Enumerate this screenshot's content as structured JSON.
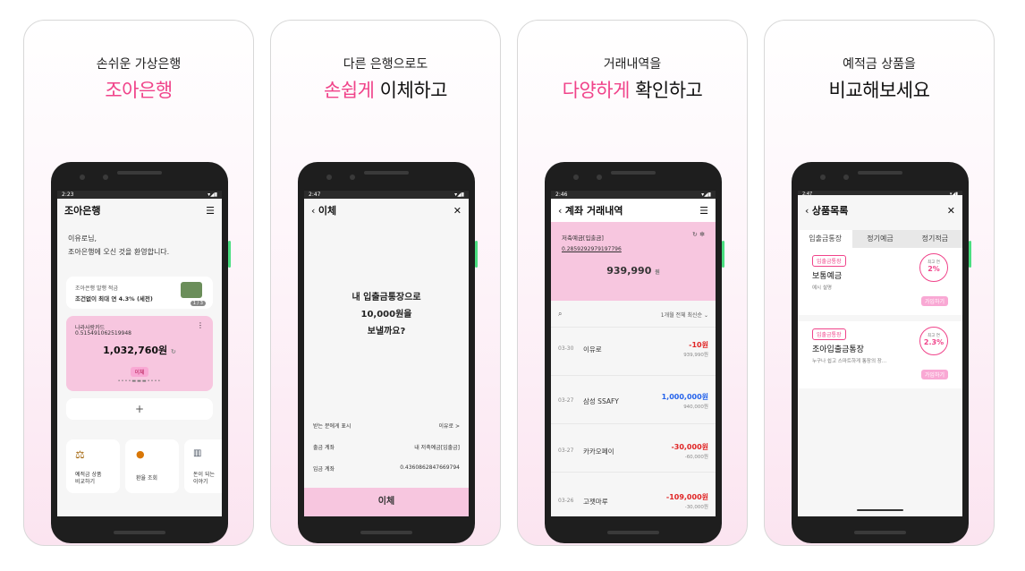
{
  "panels": [
    {
      "caption_line1": "손쉬운 가상은행",
      "caption_highlight": "조아은행",
      "caption_rest": ""
    },
    {
      "caption_line1": "다른 은행으로도",
      "caption_highlight": "손쉽게",
      "caption_rest": " 이체하고"
    },
    {
      "caption_line1": "거래내역을",
      "caption_highlight": "다양하게",
      "caption_rest": " 확인하고"
    },
    {
      "caption_line1": "예적금 상품을",
      "caption_highlight": "",
      "caption_rest": "비교해보세요"
    }
  ],
  "screen1": {
    "time": "2:23",
    "title": "조아은행",
    "welcome_line1": "이유로님,",
    "welcome_line2": "조아은행에 오신 것을 환영합니다.",
    "promo_line1": "조아은행 발행 적금",
    "promo_line2": "조건없이 최대 연 4.3% (세전)",
    "promo_page": "1 / 3",
    "account_name": "나라사랑카드",
    "account_number": "0.515491062519948",
    "balance": "1,032,760원",
    "transfer_btn": "이체",
    "add_btn": "+",
    "quick": [
      {
        "label1": "예적금 상품",
        "label2": "비교하기"
      },
      {
        "label1": "환율 조회",
        "label2": ""
      },
      {
        "label1": "돈이 되는",
        "label2": "이야기"
      }
    ]
  },
  "screen2": {
    "time": "2:47",
    "title": "이체",
    "q1": "내 입출금통장으로",
    "q2": "10,000원을",
    "q3": "보낼까요?",
    "rows": [
      {
        "label": "받는 분에게 표시",
        "value": "이유로 >"
      },
      {
        "label": "출금 계좌",
        "value": "내 저축예금[입출금]"
      },
      {
        "label": "입금 계좌",
        "value": "0.4360862847669794"
      }
    ],
    "button": "이체"
  },
  "screen3": {
    "time": "2:46",
    "title": "계좌 거래내역",
    "account_type": "저축예금[입출금]",
    "account_number": "0.2859292979197796",
    "balance": "939,990",
    "balance_unit": "원",
    "filter": "1개월 전체 최신순",
    "transactions": [
      {
        "date": "03-30",
        "name": "이유로",
        "amount": "-10원",
        "after": "939,990원",
        "type": "out"
      },
      {
        "date": "03-27",
        "name": "삼성 SSAFY",
        "amount": "1,000,000원",
        "after": "940,000원",
        "type": "in"
      },
      {
        "date": "03-27",
        "name": "카카오페이",
        "amount": "-30,000원",
        "after": "-60,000원",
        "type": "out"
      },
      {
        "date": "03-26",
        "name": "고젯마루",
        "amount": "-109,000원",
        "after": "-30,000원",
        "type": "out"
      }
    ]
  },
  "screen4": {
    "time": "2:47",
    "title": "상품목록",
    "tabs": [
      "입출금통장",
      "정기예금",
      "정기적금"
    ],
    "products": [
      {
        "badge": "입출금통장",
        "name": "보통예금",
        "desc": "예시 설명",
        "rate_label": "최고 연",
        "rate": "2%",
        "button": "가입하기"
      },
      {
        "badge": "입출금통장",
        "name": "조아입출금통장",
        "desc": "누구나 쉽고 스마트하게 통장의 장...",
        "rate_label": "최고 연",
        "rate": "2.3%",
        "button": "가입하기"
      }
    ]
  },
  "colors": {
    "accent": "#f0438a",
    "pink_card": "#f7c6df",
    "minus": "#e02424",
    "plus": "#2563eb"
  }
}
